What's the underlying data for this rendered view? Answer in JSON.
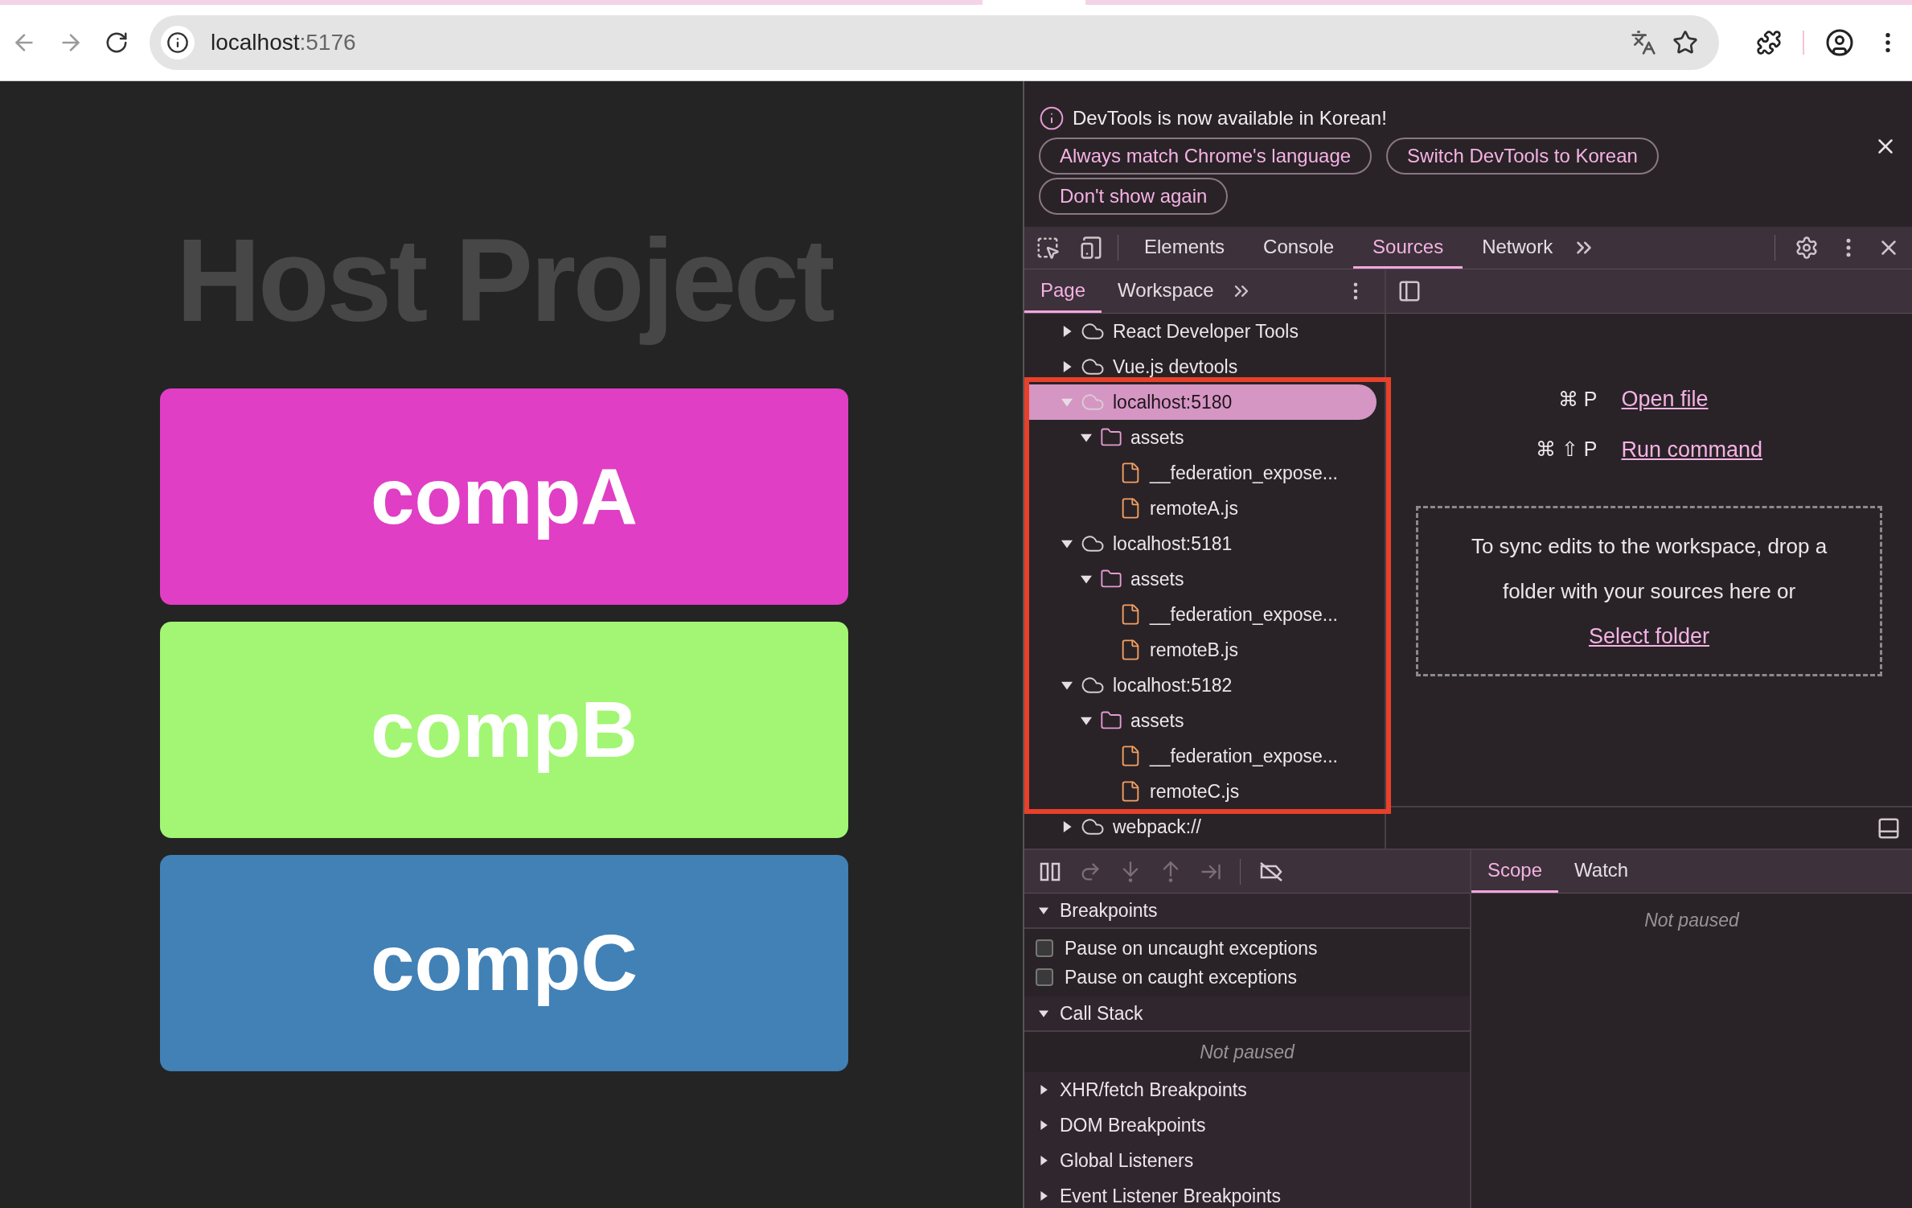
{
  "browser": {
    "url_host": "localhost",
    "url_port": ":5176"
  },
  "page": {
    "title": "Host Project",
    "cards": [
      {
        "label": "compA",
        "color": "#e03ec5"
      },
      {
        "label": "compB",
        "color": "#a2f673"
      },
      {
        "label": "compC",
        "color": "#4181b6"
      }
    ]
  },
  "devtools": {
    "infobar": {
      "message": "DevTools is now available in Korean!",
      "buttons": [
        "Always match Chrome's language",
        "Switch DevTools to Korean",
        "Don't show again"
      ]
    },
    "tabs": [
      {
        "label": "Elements",
        "selected": false
      },
      {
        "label": "Console",
        "selected": false
      },
      {
        "label": "Sources",
        "selected": true
      },
      {
        "label": "Network",
        "selected": false
      }
    ],
    "navigator_tabs": [
      {
        "label": "Page",
        "selected": true
      },
      {
        "label": "Workspace",
        "selected": false
      }
    ],
    "tree": [
      {
        "kind": "host",
        "label": "React Developer Tools",
        "expanded": false,
        "selected": false
      },
      {
        "kind": "host",
        "label": "Vue.js devtools",
        "expanded": false,
        "selected": false
      },
      {
        "kind": "host",
        "label": "localhost:5180",
        "expanded": true,
        "selected": true,
        "highlighted": true,
        "children": [
          {
            "kind": "folder",
            "label": "assets",
            "expanded": true,
            "selected": false,
            "children": [
              {
                "kind": "file",
                "label": "__federation_expose...",
                "selected": false
              },
              {
                "kind": "file",
                "label": "remoteA.js",
                "selected": false
              }
            ]
          }
        ]
      },
      {
        "kind": "host",
        "label": "localhost:5181",
        "expanded": true,
        "selected": false,
        "highlighted": true,
        "children": [
          {
            "kind": "folder",
            "label": "assets",
            "expanded": true,
            "selected": false,
            "children": [
              {
                "kind": "file",
                "label": "__federation_expose...",
                "selected": false
              },
              {
                "kind": "file",
                "label": "remoteB.js",
                "selected": false
              }
            ]
          }
        ]
      },
      {
        "kind": "host",
        "label": "localhost:5182",
        "expanded": true,
        "selected": false,
        "highlighted": true,
        "children": [
          {
            "kind": "folder",
            "label": "assets",
            "expanded": true,
            "selected": false,
            "children": [
              {
                "kind": "file",
                "label": "__federation_expose...",
                "selected": false
              },
              {
                "kind": "file",
                "label": "remoteC.js",
                "selected": false
              }
            ]
          }
        ]
      },
      {
        "kind": "host",
        "label": "webpack://",
        "expanded": false,
        "selected": false
      }
    ],
    "quick_open": [
      {
        "keys": "⌘ P",
        "label": "Open file"
      },
      {
        "keys": "⌘ ⇧ P",
        "label": "Run command"
      }
    ],
    "drop_zone": {
      "text": "To sync edits to the workspace, drop a folder with your sources here or",
      "link": "Select folder"
    },
    "debugger": [
      {
        "title": "Breakpoints",
        "expanded": true,
        "checkboxes": [
          {
            "label": "Pause on uncaught exceptions",
            "checked": false
          },
          {
            "label": "Pause on caught exceptions",
            "checked": false
          }
        ]
      },
      {
        "title": "Call Stack",
        "expanded": true,
        "message": "Not paused"
      },
      {
        "title": "XHR/fetch Breakpoints",
        "expanded": false
      },
      {
        "title": "DOM Breakpoints",
        "expanded": false
      },
      {
        "title": "Global Listeners",
        "expanded": false
      },
      {
        "title": "Event Listener Breakpoints",
        "expanded": false
      }
    ],
    "side_tabs": [
      {
        "label": "Scope",
        "selected": true
      },
      {
        "label": "Watch",
        "selected": false
      }
    ],
    "scope_message": "Not paused"
  }
}
